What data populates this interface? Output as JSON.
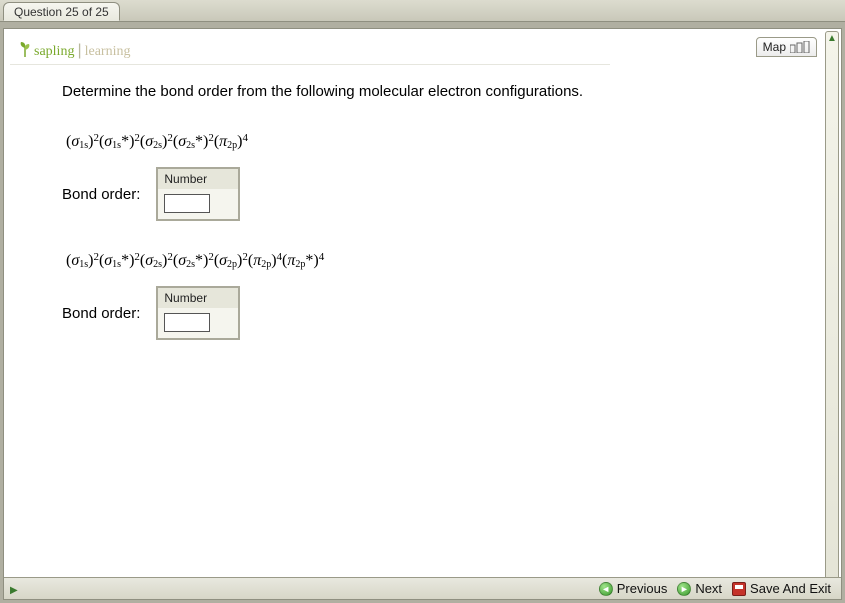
{
  "header": {
    "question_tab": "Question 25 of 25",
    "map_label": "Map",
    "brand_a": "sapling",
    "brand_b": "learning"
  },
  "prompt": "Determine the bond order from the following molecular electron configurations.",
  "problems": [
    {
      "config_html": "(<span class='ital'>σ</span><sub>1s</sub>)<sup>2</sup>(<span class='ital'>σ</span><sub>1s</sub>*)<sup>2</sup>(<span class='ital'>σ</span><sub>2s</sub>)<sup>2</sup>(<span class='ital'>σ</span><sub>2s</sub>*)<sup>2</sup>(<span class='ital'>π</span><sub>2p</sub>)<sup>4</sup>",
      "label": "Bond order:",
      "number_header": "Number",
      "value": ""
    },
    {
      "config_html": "(<span class='ital'>σ</span><sub>1s</sub>)<sup>2</sup>(<span class='ital'>σ</span><sub>1s</sub>*)<sup>2</sup>(<span class='ital'>σ</span><sub>2s</sub>)<sup>2</sup>(<span class='ital'>σ</span><sub>2s</sub>*)<sup>2</sup>(<span class='ital'>σ</span><sub>2p</sub>)<sup>2</sup>(<span class='ital'>π</span><sub>2p</sub>)<sup>4</sup>(<span class='ital'>π</span><sub>2p</sub>*)<sup>4</sup>",
      "label": "Bond order:",
      "number_header": "Number",
      "value": ""
    }
  ],
  "nav": {
    "previous": "Previous",
    "next": "Next",
    "save": "Save And Exit"
  }
}
